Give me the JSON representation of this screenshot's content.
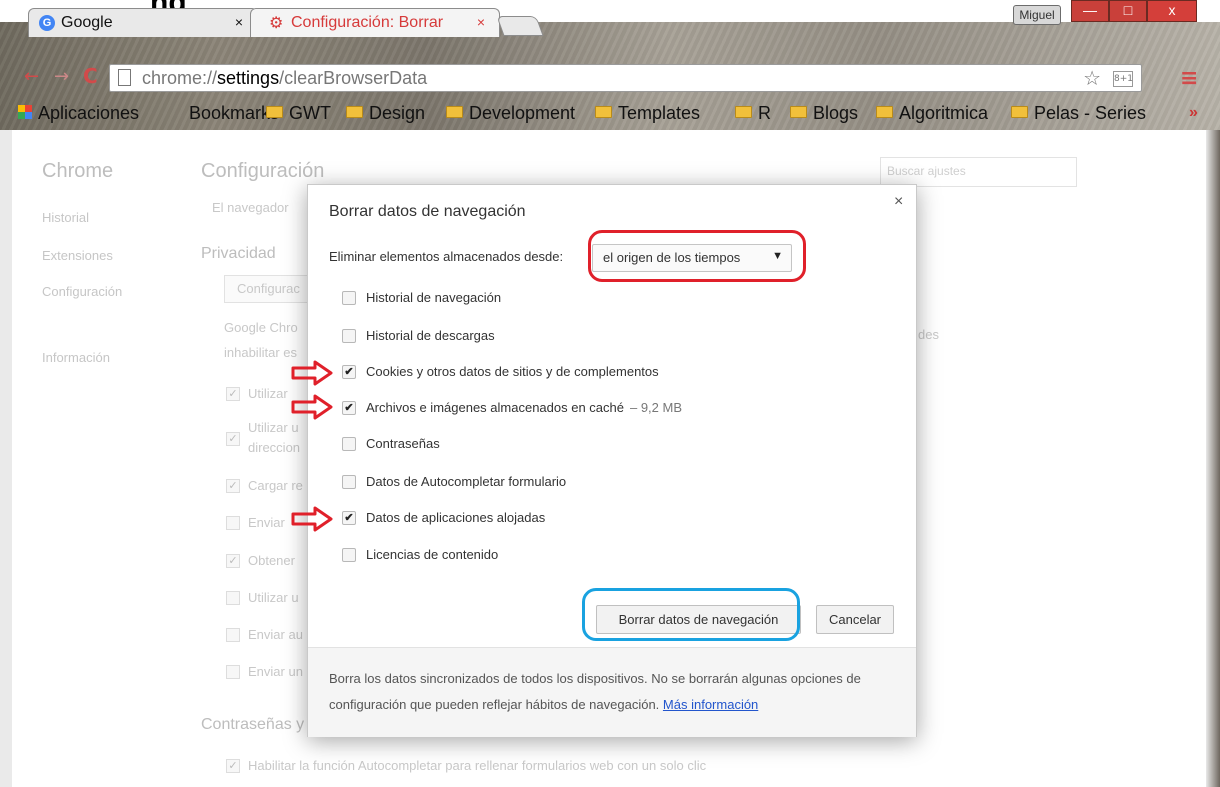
{
  "window": {
    "header_text": "ng",
    "user_badge": "Miguel",
    "min_label": "—",
    "max_label": "□",
    "close_label": "x"
  },
  "tabs": [
    {
      "title": "Google",
      "close": "×",
      "favicon": "G"
    },
    {
      "title": "Configuración: Borrar",
      "close": "×"
    }
  ],
  "toolbar": {
    "url_prefix": "chrome://",
    "url_host": "settings",
    "url_path": "/clearBrowserData",
    "ext_label": "8+1"
  },
  "bookmarks": [
    {
      "label": "Aplicaciones",
      "icon": "apps-icon"
    },
    {
      "label": "Bookmarks",
      "icon": "none"
    },
    {
      "label": "GWT",
      "icon": "folder-icon"
    },
    {
      "label": "Design",
      "icon": "folder-icon"
    },
    {
      "label": "Development",
      "icon": "folder-icon"
    },
    {
      "label": "Templates",
      "icon": "folder-icon"
    },
    {
      "label": "R",
      "icon": "folder-icon"
    },
    {
      "label": "Blogs",
      "icon": "folder-icon"
    },
    {
      "label": "Algoritmica",
      "icon": "folder-icon"
    },
    {
      "label": "Pelas - Series",
      "icon": "folder-icon"
    }
  ],
  "bookmarks_more": "»",
  "sidebar": {
    "title": "Chrome",
    "items": [
      "Historial",
      "Extensiones",
      "Configuración",
      "Información"
    ]
  },
  "settings_bg": {
    "title": "Configuración",
    "search_placeholder": "Buscar ajustes",
    "intro": "El navegador",
    "privacy_heading": "Privacidad",
    "config_button": "Configurac",
    "google_line1": "Google Chro",
    "google_line2": "inhabilitar es",
    "google_tail": "des",
    "items": [
      "Utilizar",
      "Utilizar u",
      "direccion",
      "Cargar re",
      "Enviar",
      "Obtener",
      "Utilizar u",
      "Enviar au",
      "Enviar un"
    ],
    "passwords_heading": "Contraseñas y",
    "autofill_line": "Habilitar la función Autocompletar para rellenar formularios web con un solo clic"
  },
  "dialog": {
    "title": "Borrar datos de navegación",
    "close": "×",
    "remove_label": "Eliminar elementos almacenados desde:",
    "time_range": "el origen de los tiempos",
    "options": [
      {
        "label": "Historial de navegación",
        "checked": false,
        "size": ""
      },
      {
        "label": "Historial de descargas",
        "checked": false,
        "size": ""
      },
      {
        "label": "Cookies y otros datos de sitios y de complementos",
        "checked": true,
        "size": ""
      },
      {
        "label": "Archivos e imágenes almacenados en caché",
        "checked": true,
        "size": "–  9,2 MB"
      },
      {
        "label": "Contraseñas",
        "checked": false,
        "size": ""
      },
      {
        "label": "Datos de Autocompletar formulario",
        "checked": false,
        "size": ""
      },
      {
        "label": "Datos de aplicaciones alojadas",
        "checked": true,
        "size": ""
      },
      {
        "label": "Licencias de contenido",
        "checked": false,
        "size": ""
      }
    ],
    "clear_button": "Borrar datos de navegación",
    "cancel_button": "Cancelar",
    "footer_text": "Borra los datos sincronizados de todos los dispositivos. No se borrarán algunas opciones de configuración que pueden reflejar hábitos de navegación.",
    "footer_link": "Más información"
  },
  "annotations": {
    "red": "#e0202a",
    "blue": "#19a2e0"
  }
}
